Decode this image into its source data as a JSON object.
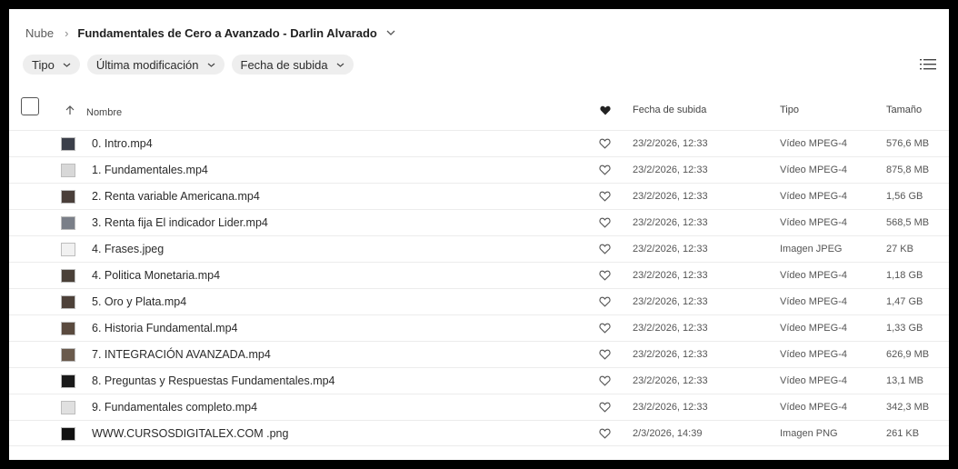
{
  "breadcrumb": {
    "root": "Nube",
    "current": "Fundamentales de Cero a Avanzado - Darlin Alvarado"
  },
  "filters": [
    {
      "label": "Tipo"
    },
    {
      "label": "Última modificación"
    },
    {
      "label": "Fecha de subida"
    }
  ],
  "columns": {
    "name": "Nombre",
    "uploaded": "Fecha de subida",
    "type": "Tipo",
    "size": "Tamaño"
  },
  "files": [
    {
      "name": "0. Intro.mp4",
      "uploaded": "23/2/2026, 12:33",
      "type": "Vídeo MPEG-4",
      "size": "576,6 MB",
      "thumb_color": "#3b3f4a"
    },
    {
      "name": "1. Fundamentales.mp4",
      "uploaded": "23/2/2026, 12:33",
      "type": "Vídeo MPEG-4",
      "size": "875,8 MB",
      "thumb_color": "#d8d8d8"
    },
    {
      "name": "2. Renta variable Americana.mp4",
      "uploaded": "23/2/2026, 12:33",
      "type": "Vídeo MPEG-4",
      "size": "1,56 GB",
      "thumb_color": "#4a3f3a"
    },
    {
      "name": "3. Renta fija El indicador Lider.mp4",
      "uploaded": "23/2/2026, 12:33",
      "type": "Vídeo MPEG-4",
      "size": "568,5 MB",
      "thumb_color": "#7a7f88"
    },
    {
      "name": "4. Frases.jpeg",
      "uploaded": "23/2/2026, 12:33",
      "type": "Imagen JPEG",
      "size": "27 KB",
      "thumb_color": "#f1f1f1"
    },
    {
      "name": "4. Politica Monetaria.mp4",
      "uploaded": "23/2/2026, 12:33",
      "type": "Vídeo MPEG-4",
      "size": "1,18 GB",
      "thumb_color": "#4a4038"
    },
    {
      "name": "5. Oro y Plata.mp4",
      "uploaded": "23/2/2026, 12:33",
      "type": "Vídeo MPEG-4",
      "size": "1,47 GB",
      "thumb_color": "#4d4139"
    },
    {
      "name": "6. Historia Fundamental.mp4",
      "uploaded": "23/2/2026, 12:33",
      "type": "Vídeo MPEG-4",
      "size": "1,33 GB",
      "thumb_color": "#5a4a3e"
    },
    {
      "name": "7. INTEGRACIÓN AVANZADA.mp4",
      "uploaded": "23/2/2026, 12:33",
      "type": "Vídeo MPEG-4",
      "size": "626,9 MB",
      "thumb_color": "#6a5a4c"
    },
    {
      "name": "8. Preguntas y Respuestas Fundamentales.mp4",
      "uploaded": "23/2/2026, 12:33",
      "type": "Vídeo MPEG-4",
      "size": "13,1 MB",
      "thumb_color": "#1a1a1a"
    },
    {
      "name": "9. Fundamentales completo.mp4",
      "uploaded": "23/2/2026, 12:33",
      "type": "Vídeo MPEG-4",
      "size": "342,3 MB",
      "thumb_color": "#e0e0e0"
    },
    {
      "name": "WWW.CURSOSDIGITALEX.COM .png",
      "uploaded": "2/3/2026, 14:39",
      "type": "Imagen PNG",
      "size": "261 KB",
      "thumb_color": "#111111"
    }
  ],
  "icons": {
    "breadcrumb_separator": "chevron-right-icon",
    "dropdown": "chevron-down-icon",
    "view_toggle": "list-view-icon",
    "sort": "arrow-up-icon",
    "favorite": "heart-icon"
  }
}
